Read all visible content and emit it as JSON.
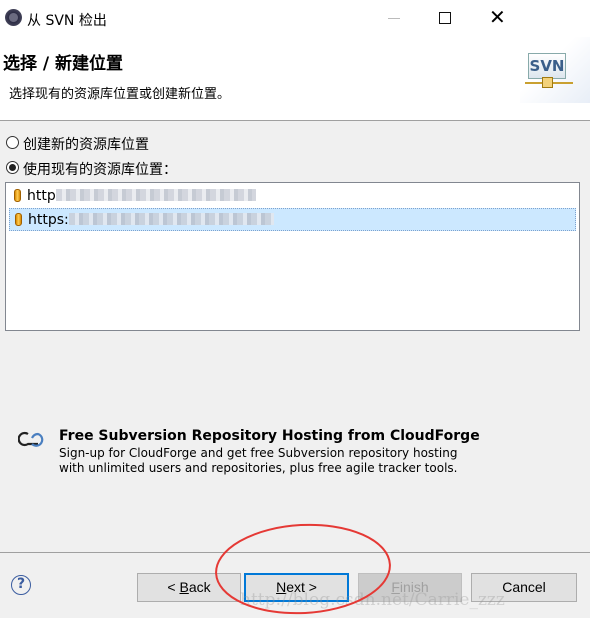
{
  "window": {
    "title": "从 SVN 检出",
    "controls": [
      "minimize",
      "maximize",
      "close"
    ]
  },
  "header": {
    "title": "选择 / 新建位置",
    "description": "选择现有的资源库位置或创建新位置。",
    "logo_text": "SVN"
  },
  "options": [
    {
      "label": "创建新的资源库位置",
      "selected": false
    },
    {
      "label": "使用现有的资源库位置：",
      "selected": true
    }
  ],
  "repositories": [
    {
      "prefix": "http",
      "selected": false,
      "icon": "repository-icon"
    },
    {
      "prefix": "https:",
      "selected": true,
      "icon": "repository-icon"
    }
  ],
  "promo": {
    "title": "Free Subversion Repository Hosting from CloudForge",
    "line1": "Sign-up for CloudForge and get free Subversion repository hosting",
    "line2": "with unlimited users and repositories, plus free agile tracker tools.",
    "icon": "cloud-icon"
  },
  "buttons": {
    "back": {
      "pre": "< ",
      "mnemonic": "B",
      "post": "ack"
    },
    "next": {
      "pre": "",
      "mnemonic": "N",
      "post": "ext >"
    },
    "finish": {
      "pre": "",
      "mnemonic": "F",
      "post": "inish",
      "disabled": true
    },
    "cancel": {
      "label": "Cancel"
    }
  },
  "watermark": "http://blog.csdn.net/Carrie_zzz",
  "colors": {
    "selection": "#cce8ff",
    "default_button": "#0078d7",
    "annotation": "#e53935"
  }
}
